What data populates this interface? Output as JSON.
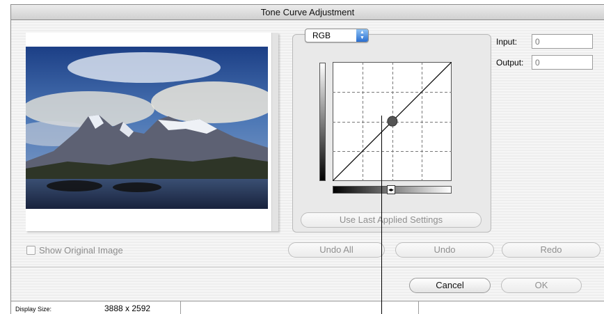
{
  "window": {
    "title": "Tone Curve Adjustment"
  },
  "preview": {
    "photo": "mountain-lake-landscape"
  },
  "curve": {
    "channel": "RGB",
    "point_input": 128,
    "point_output": 128
  },
  "fields": {
    "input_label": "Input:",
    "input_value": "0",
    "output_label": "Output:",
    "output_value": "0"
  },
  "buttons": {
    "use_last": "Use Last Applied Settings",
    "undo_all": "Undo All",
    "undo": "Undo",
    "redo": "Redo",
    "cancel": "Cancel",
    "ok": "OK"
  },
  "checkbox": {
    "show_original": "Show Original Image",
    "checked": false
  },
  "status": {
    "display_size_label": "Display Size:",
    "display_size_value": "3888 x 2592"
  },
  "icons": {
    "select": "up-down-arrows-icon",
    "slider": "double-arrow-icon"
  },
  "colors": {
    "accent": "#2a6fd0",
    "disabled_text": "#8f8f8f"
  }
}
